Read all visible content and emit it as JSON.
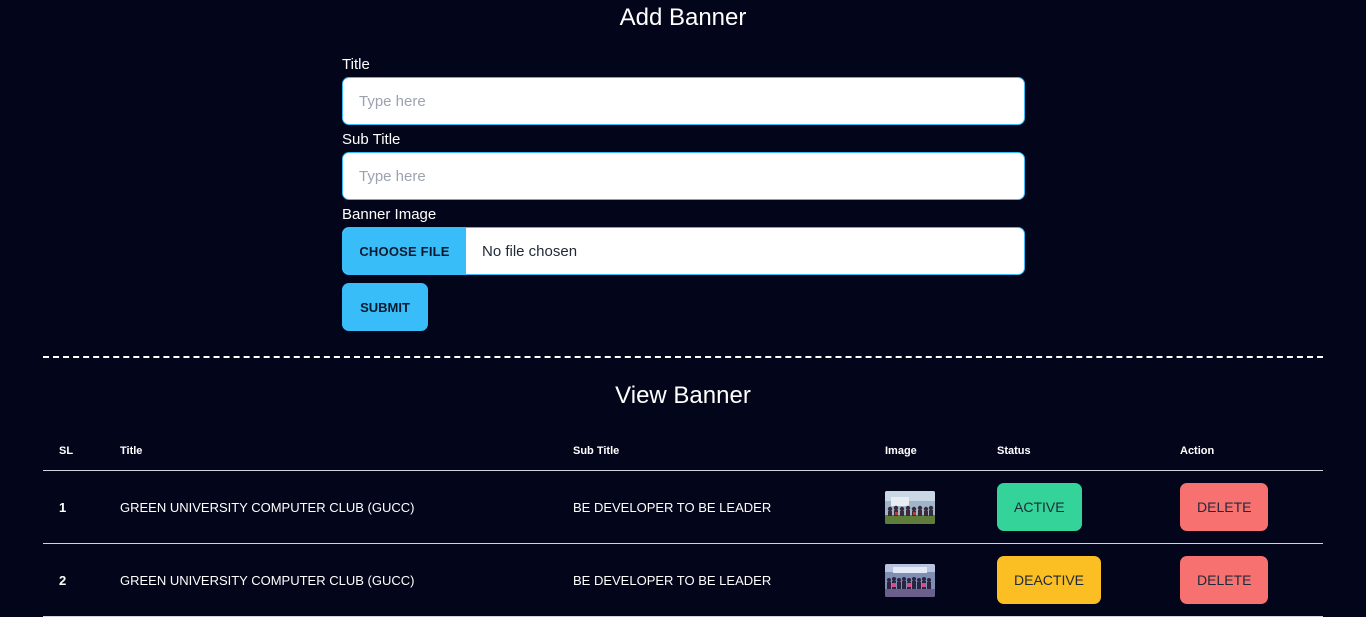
{
  "add_section": {
    "title": "Add Banner",
    "title_field": {
      "label": "Title",
      "placeholder": "Type here",
      "value": ""
    },
    "subtitle_field": {
      "label": "Sub Title",
      "placeholder": "Type here",
      "value": ""
    },
    "image_field": {
      "label": "Banner Image",
      "button_label": "CHOOSE FILE",
      "status": "No file chosen"
    },
    "submit_label": "SUBMIT"
  },
  "view_section": {
    "title": "View Banner",
    "headers": {
      "sl": "SL",
      "title": "Title",
      "subtitle": "Sub Title",
      "image": "Image",
      "status": "Status",
      "action": "Action"
    },
    "rows": [
      {
        "sl": "1",
        "title": "GREEN UNIVERSITY COMPUTER CLUB (GUCC)",
        "subtitle": "BE DEVELOPER TO BE LEADER",
        "image": "banner-thumbnail",
        "status": "ACTIVE",
        "action": "DELETE"
      },
      {
        "sl": "2",
        "title": "GREEN UNIVERSITY COMPUTER CLUB (GUCC)",
        "subtitle": "BE DEVELOPER TO BE LEADER",
        "image": "banner-thumbnail",
        "status": "DEACTIVE",
        "action": "DELETE"
      }
    ]
  },
  "colors": {
    "background": "#03061a",
    "primary": "#38bdf8",
    "active": "#34d399",
    "deactive": "#fbbf24",
    "delete": "#f87171"
  }
}
